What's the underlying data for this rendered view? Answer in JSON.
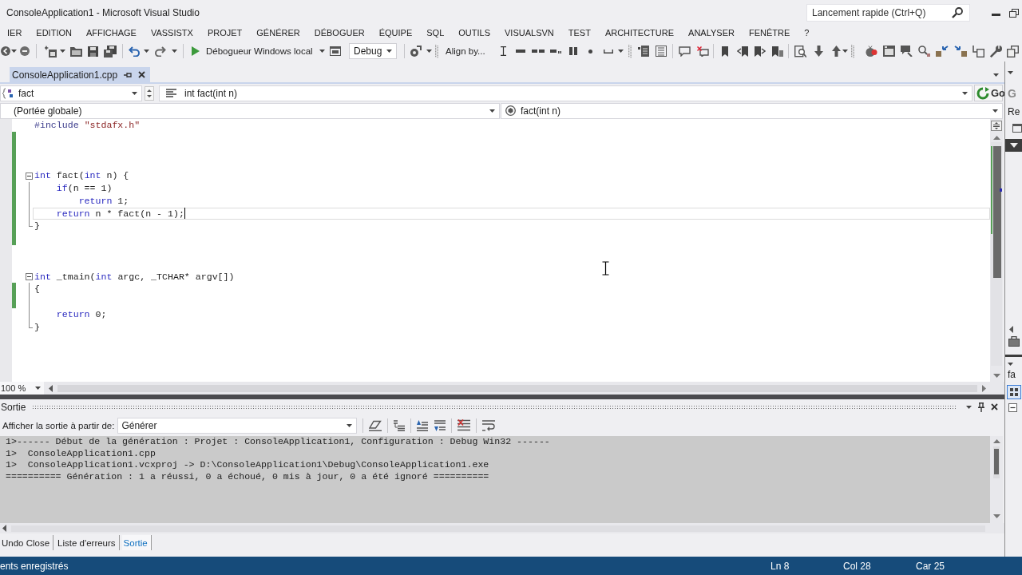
{
  "window": {
    "title": "ConsoleApplication1 - Microsoft Visual Studio",
    "quick_launch": {
      "placeholder": "Lancement rapide (Ctrl+Q)"
    }
  },
  "menu": [
    "IER",
    "EDITION",
    "AFFICHAGE",
    "VASSISTX",
    "PROJET",
    "GÉNÉRER",
    "DÉBOGUER",
    "ÉQUIPE",
    "SQL",
    "OUTILS",
    "VISUALSVN",
    "TEST",
    "ARCHITECTURE",
    "ANALYSER",
    "FENÊTRE",
    "?"
  ],
  "toolbar": {
    "debugger": "Débogueur Windows local",
    "configuration": "Debug",
    "align": "Align by..."
  },
  "document_tabs": [
    {
      "label": "ConsoleApplication1.cpp",
      "selected": true
    }
  ],
  "navigation": {
    "types": "fact",
    "members": "int fact(int n)",
    "go": "Go",
    "scope": "(Portée globale)",
    "function": "fact(int n)"
  },
  "editor": {
    "lines": [
      {
        "kind": "plain",
        "tokens": [
          {
            "text": "#include",
            "kind": "preprocessor"
          },
          {
            "text": " \"stdafx.h\"",
            "kind": "string"
          }
        ],
        "modified": false,
        "current": false
      },
      {
        "kind": "plain",
        "modified": true,
        "current": false
      },
      {
        "kind": "plain",
        "modified": true,
        "current": false
      },
      {
        "kind": "plain",
        "modified": true,
        "current": false
      },
      {
        "kind": "block_start",
        "tokens": [
          {
            "text": "int",
            "kind": "keyword"
          },
          {
            "text": " fact(",
            "kind": "plain"
          },
          {
            "text": "int",
            "kind": "keyword"
          },
          {
            "text": " n) {",
            "kind": "plain"
          }
        ],
        "modified": true,
        "current": false
      },
      {
        "kind": "plain",
        "tokens": [
          {
            "text": "    if",
            "kind": "keyword"
          },
          {
            "text": "(n == 1)",
            "kind": "plain"
          }
        ],
        "modified": true,
        "current": false
      },
      {
        "kind": "plain",
        "tokens": [
          {
            "text": "        return",
            "kind": "keyword"
          },
          {
            "text": " 1;",
            "kind": "plain"
          }
        ],
        "modified": true,
        "current": false
      },
      {
        "kind": "plain",
        "tokens": [
          {
            "text": "    return",
            "kind": "keyword"
          },
          {
            "text": " n * fact(n - 1);",
            "kind": "plain"
          }
        ],
        "modified": true,
        "current": true
      },
      {
        "kind": "block_end",
        "tokens": [
          {
            "text": "}",
            "kind": "plain"
          }
        ],
        "modified": true,
        "current": false
      },
      {
        "kind": "plain",
        "modified": true,
        "current": false
      },
      {
        "kind": "plain",
        "modified": false,
        "current": false
      },
      {
        "kind": "plain",
        "modified": false,
        "current": false
      },
      {
        "kind": "block_start",
        "tokens": [
          {
            "text": "int",
            "kind": "keyword"
          },
          {
            "text": " _tmain(",
            "kind": "plain"
          },
          {
            "text": "int",
            "kind": "keyword"
          },
          {
            "text": " argc, _TCHAR* argv[])",
            "kind": "plain"
          }
        ],
        "modified": false,
        "current": false
      },
      {
        "kind": "plain",
        "tokens": [
          {
            "text": "{",
            "kind": "plain"
          }
        ],
        "modified": true,
        "current": false
      },
      {
        "kind": "plain",
        "modified": true,
        "current": false
      },
      {
        "kind": "plain",
        "tokens": [
          {
            "text": "    return",
            "kind": "keyword"
          },
          {
            "text": " 0;",
            "kind": "plain"
          }
        ],
        "modified": false,
        "current": false
      },
      {
        "kind": "block_end",
        "tokens": [
          {
            "text": "}",
            "kind": "plain"
          }
        ],
        "modified": false,
        "current": false
      }
    ],
    "zoom": "100 %"
  },
  "output": {
    "title": "Sortie",
    "source_label": "Afficher la sortie à partir de:",
    "source": "Générer",
    "lines": [
      "1>------ Début de la génération : Projet : ConsoleApplication1, Configuration : Debug Win32 ------",
      "1>  ConsoleApplication1.cpp",
      "1>  ConsoleApplication1.vcxproj -> D:\\ConsoleApplication1\\Debug\\ConsoleApplication1.exe",
      "========== Génération : 1 a réussi, 0 a échoué, 0 mis à jour, 0 a été ignoré =========="
    ]
  },
  "bottom_tabs": [
    {
      "label": "Undo Close",
      "selected": false
    },
    {
      "label": "Liste d'erreurs",
      "selected": false
    },
    {
      "label": "Sortie",
      "selected": true
    }
  ],
  "status_bar": {
    "message": "ents enregistrés",
    "line": "Ln 8",
    "column": "Col 28",
    "character": "Car 25"
  },
  "side_panel": {
    "upper_label": "G",
    "upper_row": "Re",
    "lower_row": "fa"
  }
}
